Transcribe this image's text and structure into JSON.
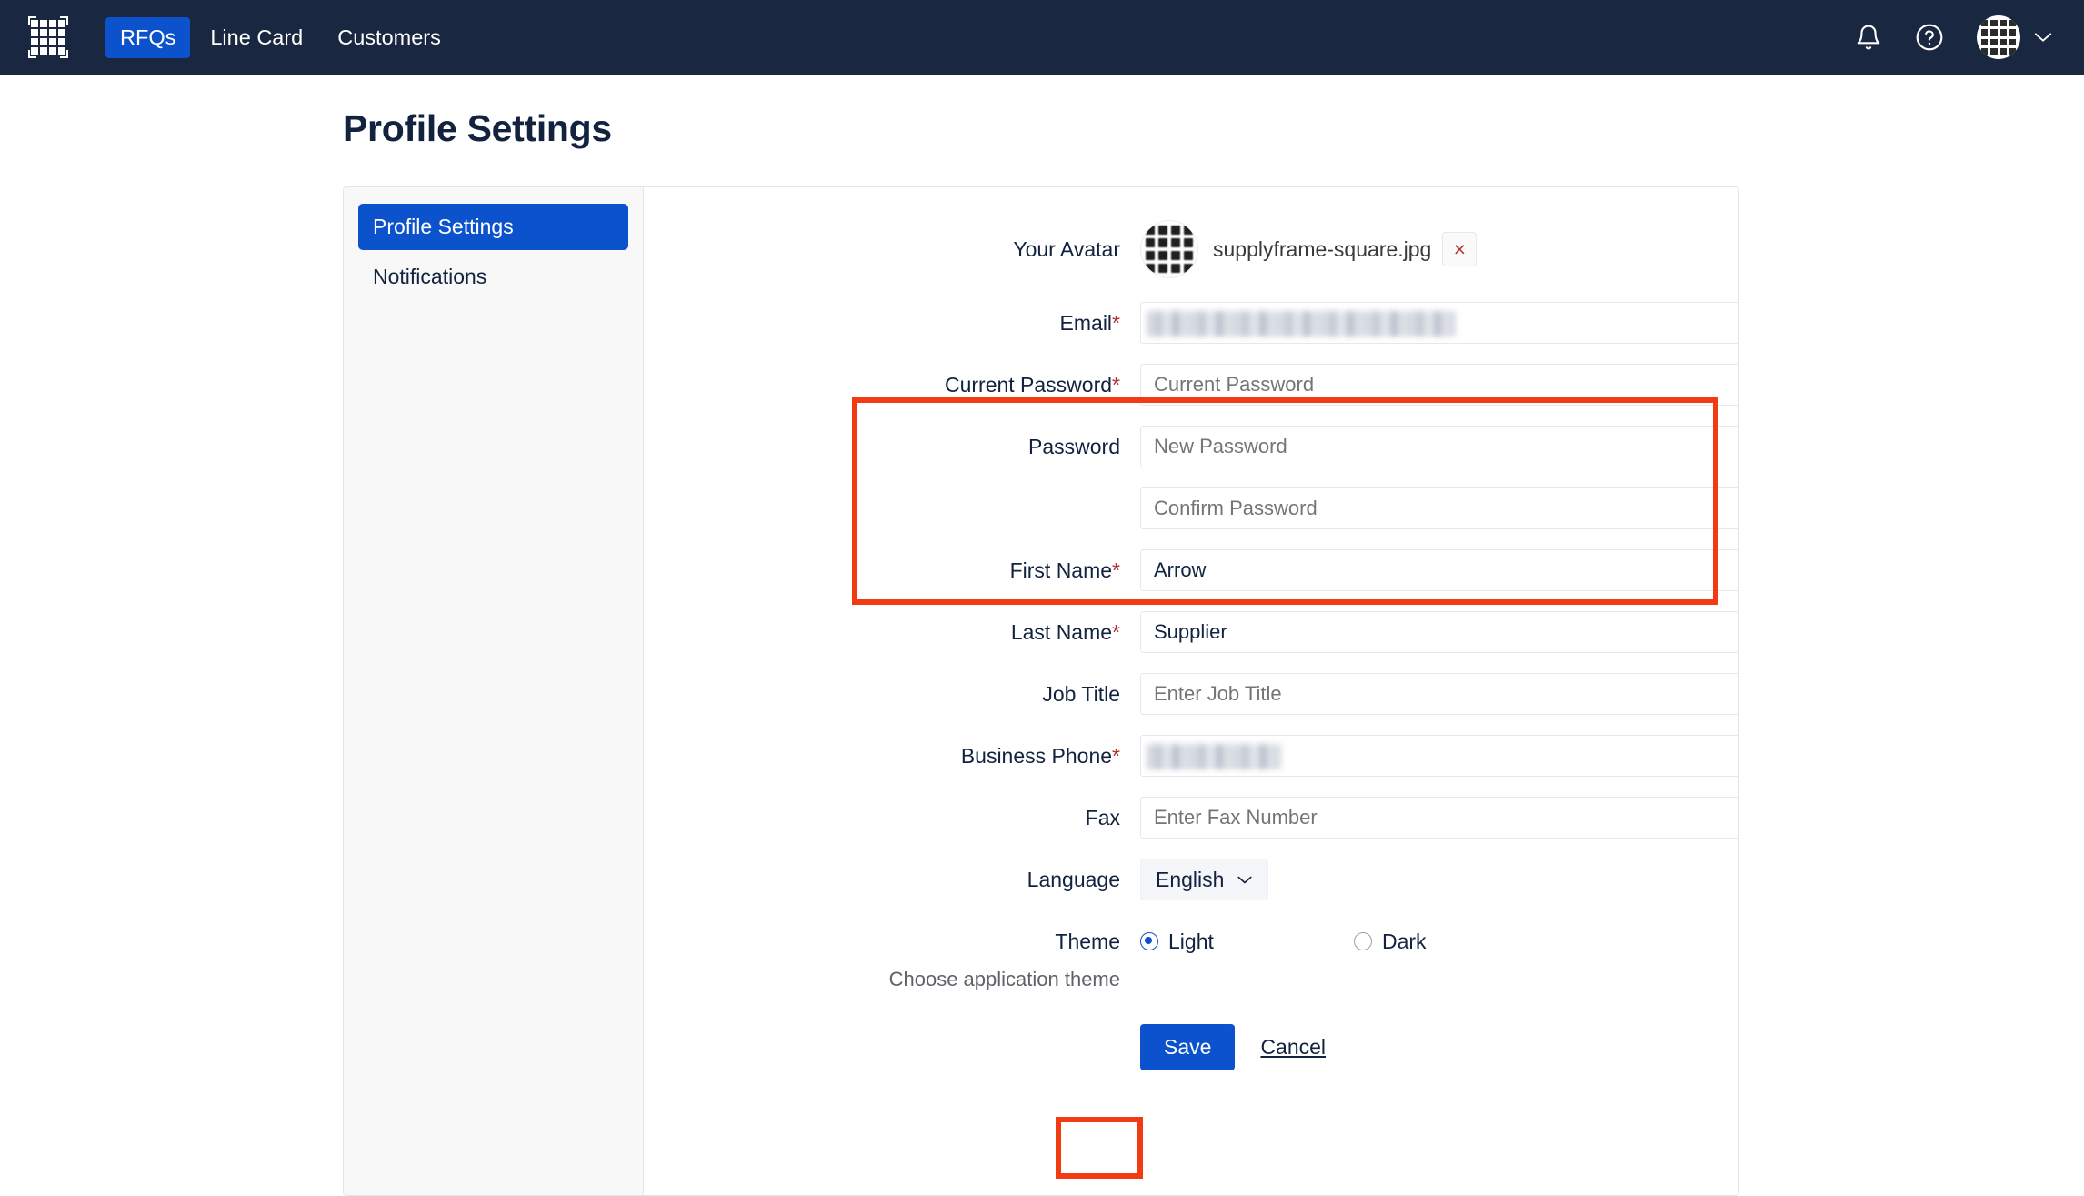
{
  "nav": {
    "logo_name": "supplyframe-grid-logo",
    "links": [
      {
        "label": "RFQs",
        "active": true
      },
      {
        "label": "Line Card",
        "active": false
      },
      {
        "label": "Customers",
        "active": false
      }
    ],
    "bell_icon": "bell-icon",
    "help_icon": "question-circle-icon",
    "avatar_icon": "user-avatar-grid",
    "chevron_icon": "chevron-down-icon"
  },
  "page": {
    "title": "Profile Settings"
  },
  "sidebar": {
    "items": [
      {
        "label": "Profile Settings",
        "active": true
      },
      {
        "label": "Notifications",
        "active": false
      }
    ]
  },
  "form": {
    "avatar": {
      "label": "Your Avatar",
      "filename": "supplyframe-square.jpg",
      "remove_label": "×"
    },
    "email": {
      "label": "Email",
      "required": "*",
      "value": "",
      "redacted": true
    },
    "current_password": {
      "label": "Current Password",
      "required": "*",
      "placeholder": "Current Password",
      "value": ""
    },
    "password": {
      "label": "Password",
      "placeholder": "New Password",
      "value": ""
    },
    "confirm_password": {
      "label": "",
      "placeholder": "Confirm Password",
      "value": ""
    },
    "first_name": {
      "label": "First Name",
      "required": "*",
      "value": "Arrow"
    },
    "last_name": {
      "label": "Last Name",
      "required": "*",
      "value": "Supplier"
    },
    "job_title": {
      "label": "Job Title",
      "placeholder": "Enter Job Title",
      "value": ""
    },
    "business_phone": {
      "label": "Business Phone",
      "required": "*",
      "value": "",
      "redacted": true
    },
    "fax": {
      "label": "Fax",
      "placeholder": "Enter Fax Number",
      "value": ""
    },
    "language": {
      "label": "Language",
      "selected": "English",
      "options": [
        "English"
      ],
      "chevron_icon": "chevron-down-icon"
    },
    "theme": {
      "label": "Theme",
      "helper": "Choose application theme",
      "options": [
        {
          "label": "Light",
          "selected": true
        },
        {
          "label": "Dark",
          "selected": false
        }
      ]
    },
    "actions": {
      "save_label": "Save",
      "cancel_label": "Cancel"
    }
  },
  "colors": {
    "nav_background": "#1a2740",
    "accent_blue": "#0b52cc",
    "annotation_red": "#f23b12",
    "text_dark": "#13233f",
    "required_red": "#b03030",
    "sidebar_background": "#f8f8f9"
  },
  "annotations": [
    {
      "name": "password-section-highlight",
      "color": "#f23b12"
    },
    {
      "name": "save-button-highlight",
      "color": "#f23b12"
    }
  ]
}
